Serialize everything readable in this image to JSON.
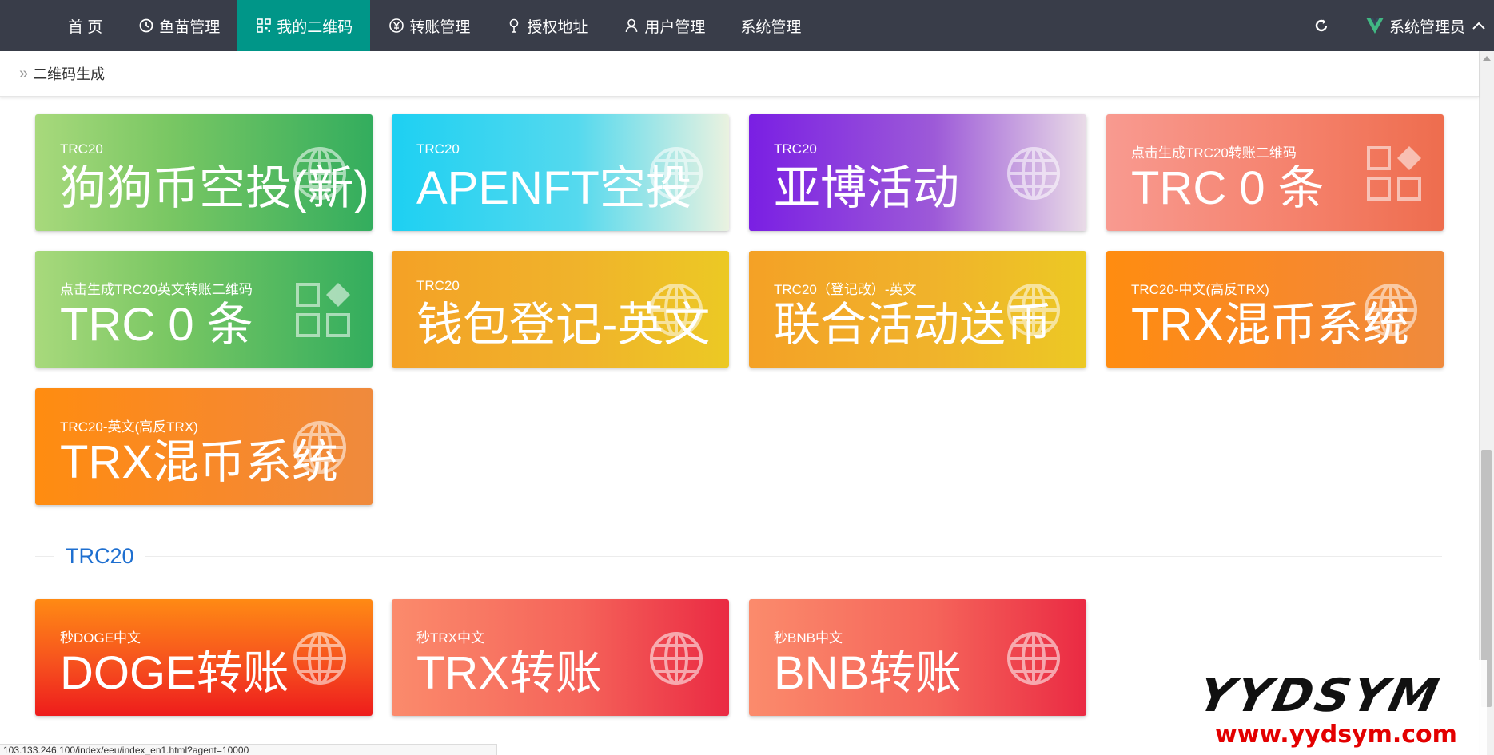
{
  "nav": {
    "items": [
      {
        "label": "首 页",
        "icon": "",
        "active": false
      },
      {
        "label": "鱼苗管理",
        "icon": "clock-icon",
        "active": false
      },
      {
        "label": "我的二维码",
        "icon": "qrcode-icon",
        "active": true
      },
      {
        "label": "转账管理",
        "icon": "yen-icon",
        "active": false
      },
      {
        "label": "授权地址",
        "icon": "location-icon",
        "active": false
      },
      {
        "label": "用户管理",
        "icon": "user-icon",
        "active": false
      },
      {
        "label": "系统管理",
        "icon": "",
        "active": false
      }
    ],
    "user": "系统管理员"
  },
  "breadcrumb": {
    "text": "二维码生成"
  },
  "cards": [
    {
      "sub": "TRC20",
      "main": "狗狗币空投(新)",
      "theme": "green",
      "icon": "globe-icon"
    },
    {
      "sub": "TRC20",
      "main": "APENFT空投",
      "theme": "cyan",
      "icon": "globe-icon"
    },
    {
      "sub": "TRC20",
      "main": "亚博活动",
      "theme": "purple",
      "icon": "globe-icon"
    },
    {
      "sub": "点击生成TRC20转账二维码",
      "main": "TRC 0 条",
      "theme": "salmon",
      "icon": "apps-icon"
    },
    {
      "sub": "点击生成TRC20英文转账二维码",
      "main": "TRC 0 条",
      "theme": "green",
      "icon": "apps-icon"
    },
    {
      "sub": "TRC20",
      "main": "钱包登记-英文",
      "theme": "yellow",
      "icon": "globe-icon"
    },
    {
      "sub": "TRC20（登记改）-英文",
      "main": "联合活动送币",
      "theme": "yellow",
      "icon": "globe-icon"
    },
    {
      "sub": "TRC20-中文(高反TRX)",
      "main": "TRX混币系统",
      "theme": "orange",
      "icon": "globe-icon"
    },
    {
      "sub": "TRC20-英文(高反TRX)",
      "main": "TRX混币系统",
      "theme": "orange",
      "icon": "globe-icon"
    }
  ],
  "section": {
    "title": "TRC20"
  },
  "section_cards": [
    {
      "sub": "秒DOGE中文",
      "main": "DOGE转账",
      "theme": "red",
      "icon": "globe-icon"
    },
    {
      "sub": "秒TRX中文",
      "main": "TRX转账",
      "theme": "pink",
      "icon": "globe-icon"
    },
    {
      "sub": "秒BNB中文",
      "main": "BNB转账",
      "theme": "pink",
      "icon": "globe-icon"
    }
  ],
  "statusbar": {
    "url": "103.133.246.100/index/eeu/index_en1.html?agent=10000"
  },
  "watermark": {
    "logo": "YYDSYM",
    "url": "www.yydsym.com"
  },
  "colors": {
    "topbar": "#393d49",
    "active_nav": "#009688",
    "section_title": "#1e6fd0"
  }
}
